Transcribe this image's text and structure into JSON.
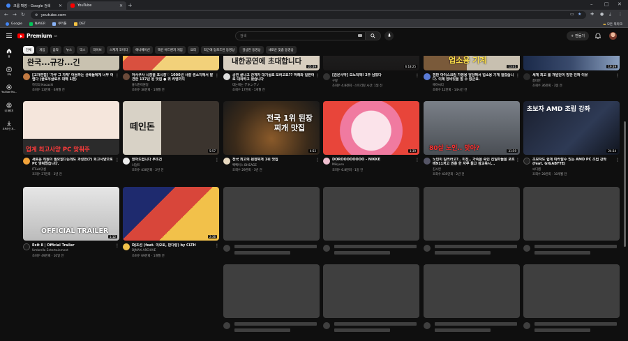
{
  "browser": {
    "tabs": [
      {
        "title": "크롬 확장 - Google 검색",
        "favicon_color": "#4285f4",
        "active": false
      },
      {
        "title": "YouTube",
        "favicon_color": "#ff0000",
        "active": true
      }
    ],
    "new_tab": "+",
    "window_controls": [
      "–",
      "□",
      "✕"
    ],
    "url": "youtube.com",
    "bookmarks": [
      {
        "label": "Google",
        "color": "#4285f4"
      },
      {
        "label": "NAVER",
        "color": "#03c75a"
      },
      {
        "label": "쿠키툴",
        "color": "#8ab4f8"
      },
      {
        "label": "DST",
        "color": "#f6c343"
      }
    ],
    "all_bookmarks": "모든 북마크"
  },
  "header": {
    "logo_text": "Premium",
    "logo_sup": "KR",
    "search_placeholder": "검색",
    "create_label": "만들기"
  },
  "sidebar": {
    "items": [
      {
        "label": "홈",
        "icon": "home-icon"
      },
      {
        "label": "Shorts",
        "icon": "shorts-icon"
      },
      {
        "label": "구독",
        "icon": "subscriptions-icon"
      },
      {
        "label": "YouTube Mu...",
        "icon": "music-icon"
      },
      {
        "label": "내 페이지",
        "icon": "you-icon"
      },
      {
        "label": "오프라인 저...",
        "icon": "download-icon"
      }
    ]
  },
  "chips": [
    "전체",
    "게임",
    "음악",
    "뉴스",
    "믹스",
    "라이브",
    "스케치 코미디",
    "애니메이션",
    "액션 어드벤처 게임",
    "요리",
    "최근에 업로드된 동영상",
    "감상한 동영상",
    "새로운 맞춤 동영상"
  ],
  "videos_row0": [
    {
      "title": "[고자면접] '가루 그 자체' 어둠하는 산배들에게 너무 어렵다 (끝로우글로우 대해 1편)",
      "channel": "하다의 Hacachi",
      "meta": "조회수 13만회 · 6개월 전",
      "duration": "",
      "thumb_text": "완국...규강...긴"
    },
    {
      "title": "아사쿠사 시장을 포시장♡ 1000년 사찰 센소지에서 발견한 137년 된 맛집 ● 퀴 리엔까지",
      "channel": "홍석천이원일",
      "meta": "조회수 30만회 · 1개월 전",
      "duration": "",
      "thumb_text": ""
    },
    {
      "title": "공연 끝나고 관계자 대기실로 모러고요?? 하례와 일본어로 대화하고 왔습니다",
      "channel": "데논애논 デネンデノ",
      "meta": "조회수 17만회 · 1개월 전",
      "duration": "25:39",
      "thumb_text": "내한공연에 초대합니다"
    },
    {
      "title": "[검은사막] 오노직책! 2주 남았다",
      "channel": "구팡",
      "meta": "조회수 4.8천회 · 스트리밍 시간: 1일 전",
      "duration": "6:18:25",
      "thumb_text": ""
    },
    {
      "title": "점판 아이스크림 가정용 담당해서 업소용 기계 질렀습니다. 이제 장비빗을 할 수 없군요.",
      "channel": "에이씨티",
      "meta": "조회수 12만회 · 14시간 전",
      "duration": "13:41",
      "thumb_text": "업소용 기계"
    },
    {
      "title": "세계 최고 룰 개임단이 망한 진짜 이유",
      "channel": "총비만",
      "meta": "조회수 36만회 · 3일 전",
      "duration": "19:39",
      "thumb_text": ""
    }
  ],
  "videos_row1": [
    {
      "title": "새로운 직원이 필요없다는데도 과성한(?) 회고사양으로 PC 맞춰줬습니다.",
      "channel": "ITSub잇섭",
      "meta": "조회수 27만회 · 2년 전",
      "duration": "",
      "thumb_text": "업계 최고사양 PC 맞춰주"
    },
    {
      "title": "받아드립니다 무조건",
      "channel": "너덜트",
      "meta": "조회수 430만회 · 2년 전",
      "duration": "5:57",
      "thumb_text": "떼인돈"
    },
    {
      "title": "전국 최고의 된장찌개 1위 맛집",
      "channel": "빽빽이스 BHEAGE",
      "meta": "조회수 29만회 · 3년 전",
      "duration": "4:52",
      "thumb_text": "전국 1위 된장찌개 맛집"
    },
    {
      "title": "DOROOOOOOOO - NIKKE",
      "channel": "Mikyuru",
      "meta": "조회수 6.8만회 · 1일 전",
      "duration": "1:39",
      "thumb_text": ""
    },
    {
      "title": "노인이 킬러라고?.. 미친.. 가족을 죽인 킨일파들을 포르베911처고 권총 한 자루 들고 참교육시...",
      "channel": "김시연",
      "meta": "조회수 435만회 · 2년 전",
      "duration": "31:59",
      "thumb_text": "80살 노인.. 맞아?"
    },
    {
      "title": "초보자도 쉽게 따라할수 있는 AMD PC 조립 강좌(feat. GIGABYTE)",
      "channel": "씨디캠",
      "meta": "조회수 28만회 · 10개월 전",
      "duration": "24:34",
      "thumb_text": "초보자 AMD 조립 강좌"
    }
  ],
  "videos_row2": [
    {
      "title": "Exit 8 | Official Trailer",
      "channel": "Umbrella Entertainment",
      "meta": "조회수 49만회 · 10일 전",
      "duration": "1:12",
      "thumb_text": "OFFICIAL TRAILER"
    },
    {
      "title": "DJ조선 (feat. 이오토, 판다랑) by CLTH",
      "channel": "DJMAX ARCHIVE",
      "meta": "조회수 69만회 · 1개월 전",
      "duration": "2:36",
      "thumb_text": ""
    }
  ]
}
